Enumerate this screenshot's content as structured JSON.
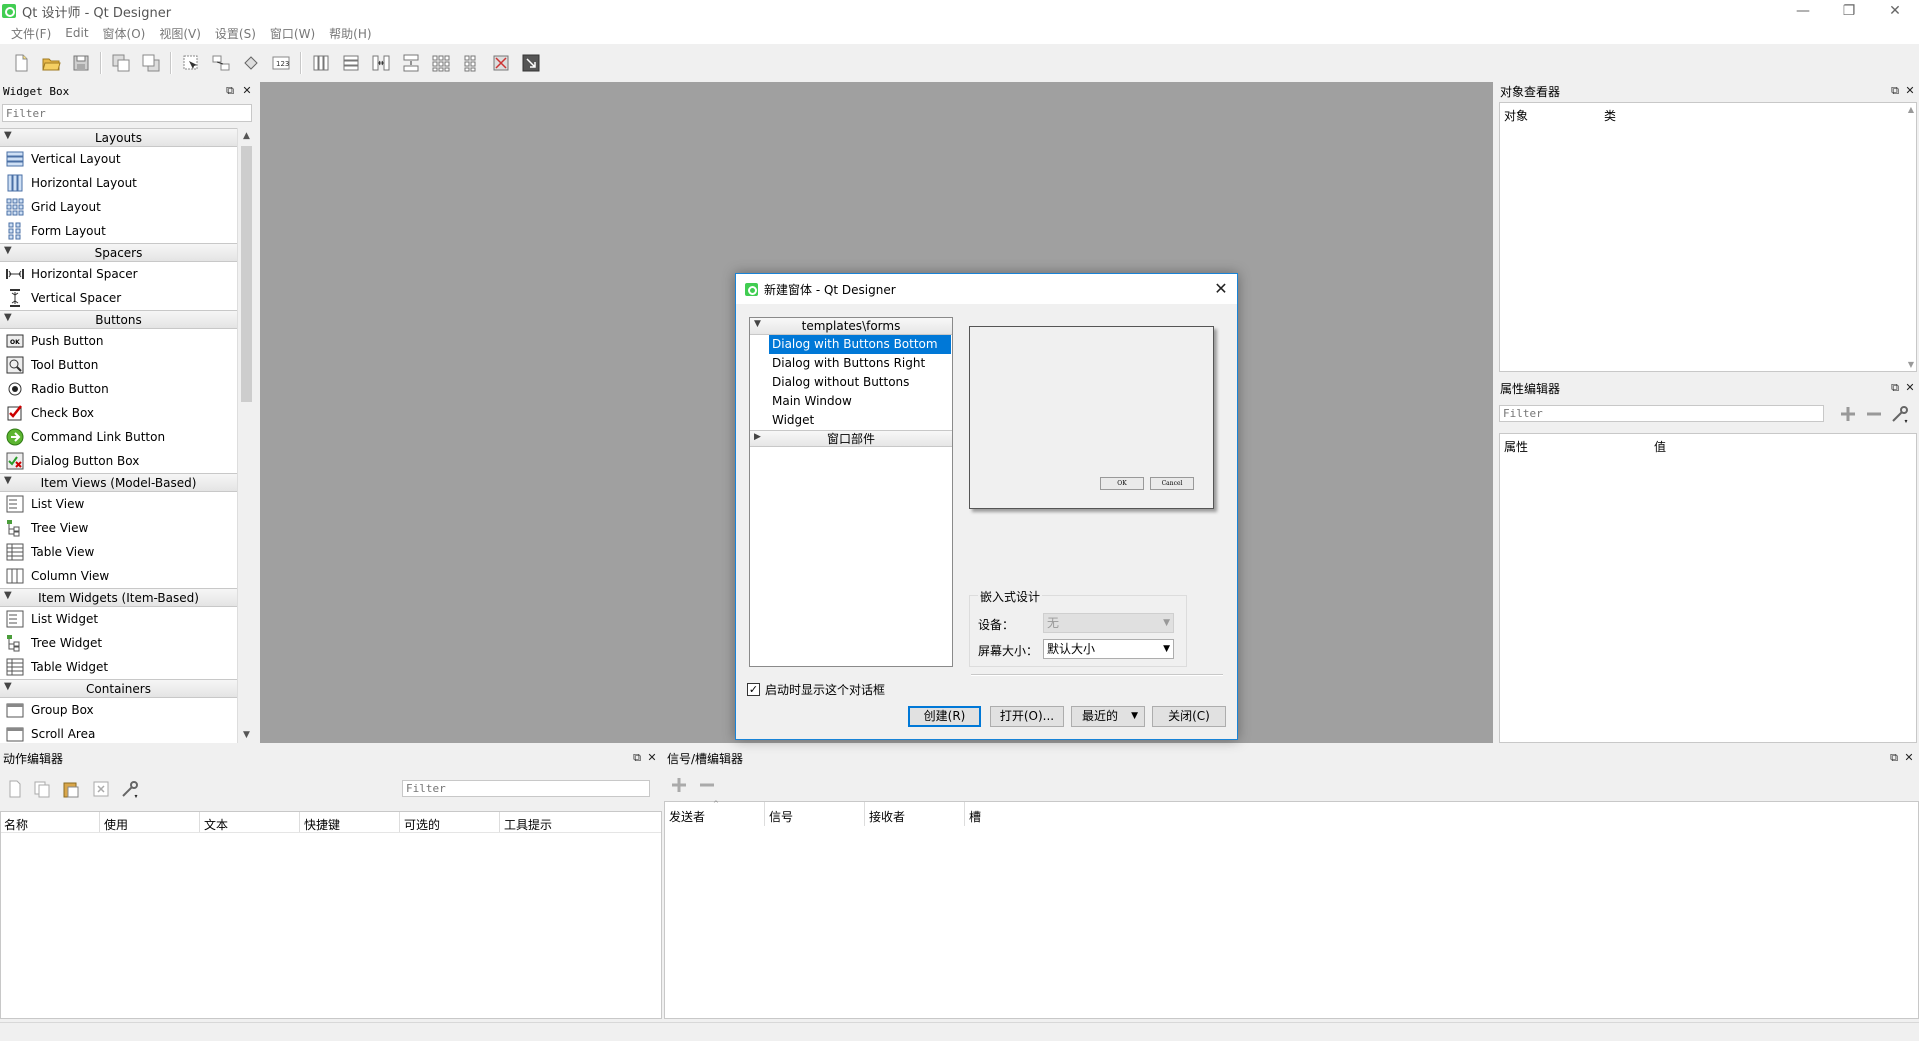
{
  "window": {
    "title": "Qt 设计师 - Qt Designer",
    "minimize": "—",
    "restore": "❐",
    "close": "✕"
  },
  "menubar": [
    "文件(F)",
    "Edit",
    "窗体(O)",
    "视图(V)",
    "设置(S)",
    "窗口(W)",
    "帮助(H)"
  ],
  "widget_box": {
    "title": "Widget Box",
    "filter_placeholder": "Filter",
    "categories": {
      "layouts": "Layouts",
      "spacers": "Spacers",
      "buttons": "Buttons",
      "item_views": "Item Views (Model-Based)",
      "item_widgets": "Item Widgets (Item-Based)",
      "containers": "Containers"
    },
    "items": {
      "vertical_layout": "Vertical Layout",
      "horizontal_layout": "Horizontal Layout",
      "grid_layout": "Grid Layout",
      "form_layout": "Form Layout",
      "horizontal_spacer": "Horizontal Spacer",
      "vertical_spacer": "Vertical Spacer",
      "push_button": "Push Button",
      "tool_button": "Tool Button",
      "radio_button": "Radio Button",
      "check_box": "Check Box",
      "command_link_button": "Command Link Button",
      "dialog_button_box": "Dialog Button Box",
      "list_view": "List View",
      "tree_view": "Tree View",
      "table_view": "Table View",
      "column_view": "Column View",
      "list_widget": "List Widget",
      "tree_widget": "Tree Widget",
      "table_widget": "Table Widget",
      "group_box": "Group Box",
      "scroll_area": "Scroll Area"
    }
  },
  "object_inspector": {
    "title": "对象查看器",
    "col_object": "对象",
    "col_class": "类"
  },
  "property_editor": {
    "title": "属性编辑器",
    "filter_placeholder": "Filter",
    "col_property": "属性",
    "col_value": "值"
  },
  "action_editor": {
    "title": "动作编辑器",
    "filter_placeholder": "Filter",
    "columns": [
      "名称",
      "使用",
      "文本",
      "快捷键",
      "可选的",
      "工具提示"
    ]
  },
  "signal_slot_editor": {
    "title": "信号/槽编辑器",
    "columns": [
      "发送者",
      "信号",
      "接收者",
      "槽"
    ]
  },
  "dialog": {
    "title": "新建窗体 - Qt Designer",
    "tree": {
      "category_templates": "templates\\forms",
      "templates": [
        "Dialog with Buttons Bottom",
        "Dialog with Buttons Right",
        "Dialog without Buttons",
        "Main Window",
        "Widget"
      ],
      "selected_index": 0,
      "category_widgets": "窗口部件"
    },
    "preview": {
      "ok": "OK",
      "cancel": "Cancel"
    },
    "embedded_design": {
      "legend": "嵌入式设计",
      "device_label": "设备：",
      "device_value": "无",
      "screen_size_label": "屏幕大小：",
      "screen_size_value": "默认大小"
    },
    "show_on_startup": {
      "label": "启动时显示这个对话框",
      "checked": true
    },
    "buttons": {
      "create": "创建(R)",
      "open": "打开(O)...",
      "recent": "最近的",
      "close": "关闭(C)"
    }
  },
  "colors": {
    "selection": "#0078d7",
    "central_bg": "#a0a0a0",
    "dialog_border": "#1883d7",
    "qt_green": "#41cd52"
  }
}
